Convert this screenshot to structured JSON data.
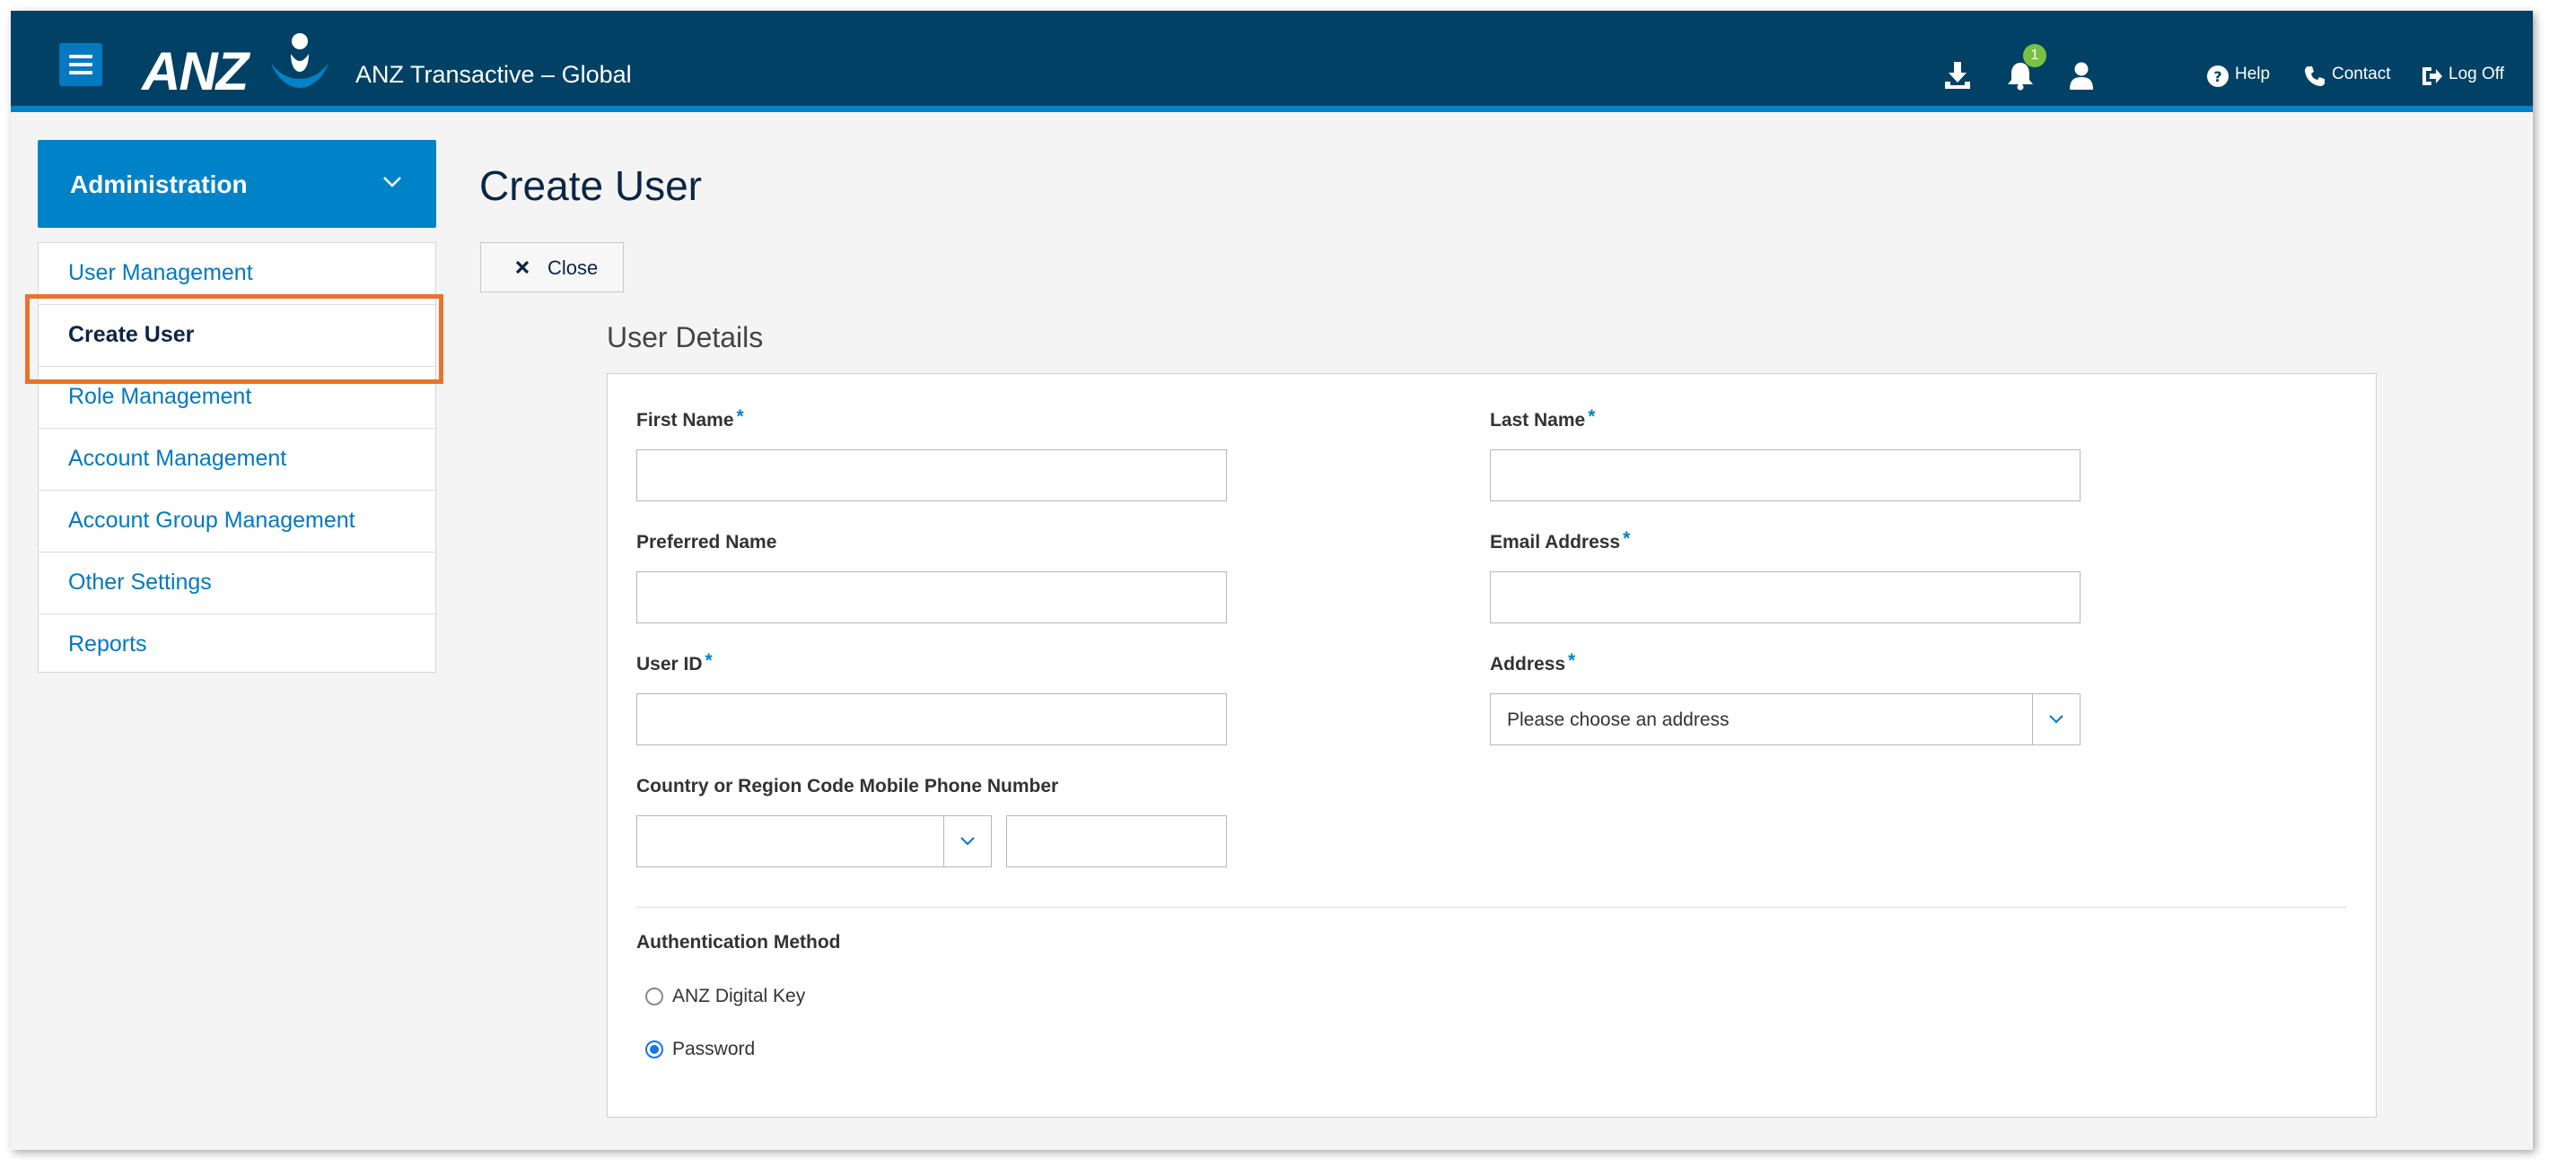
{
  "header": {
    "brand_text": "ANZ",
    "app_title": "ANZ Transactive – Global",
    "notifications_count": "1",
    "links": {
      "help": "Help",
      "contact": "Contact",
      "logoff": "Log Off"
    },
    "icons": [
      "hamburger-menu-icon",
      "download-icon",
      "bell-icon",
      "user-icon",
      "help-icon",
      "phone-icon",
      "log-off-icon"
    ]
  },
  "sidebar": {
    "section_title": "Administration",
    "items": [
      {
        "label": "User Management"
      },
      {
        "label": "Create User"
      },
      {
        "label": "Role Management"
      },
      {
        "label": "Account Management"
      },
      {
        "label": "Account Group Management"
      },
      {
        "label": "Other Settings"
      },
      {
        "label": "Reports"
      }
    ],
    "active_item": "Create User"
  },
  "main": {
    "page_title": "Create User",
    "close_label": "Close",
    "section_title": "User Details",
    "form": {
      "first_name": {
        "label": "First Name",
        "required": "*",
        "value": ""
      },
      "last_name": {
        "label": "Last Name",
        "required": "*",
        "value": ""
      },
      "preferred_name": {
        "label": "Preferred Name",
        "value": ""
      },
      "email": {
        "label": "Email Address",
        "required": "*",
        "value": ""
      },
      "user_id": {
        "label": "User ID",
        "required": "*",
        "value": ""
      },
      "address": {
        "label": "Address",
        "required": "*",
        "value": "Please choose an address"
      },
      "phone": {
        "label": "Country or Region Code Mobile Phone Number",
        "code_value": "",
        "number_value": ""
      },
      "auth": {
        "label": "Authentication Method",
        "options": [
          {
            "label": "ANZ Digital Key",
            "selected": false
          },
          {
            "label": "Password",
            "selected": true
          }
        ]
      }
    }
  },
  "colors": {
    "header_bg": "#004165",
    "accent_blue": "#0082c8",
    "link_blue": "#0079c1",
    "highlight_orange": "#e8742a",
    "badge_green": "#7ac143"
  }
}
